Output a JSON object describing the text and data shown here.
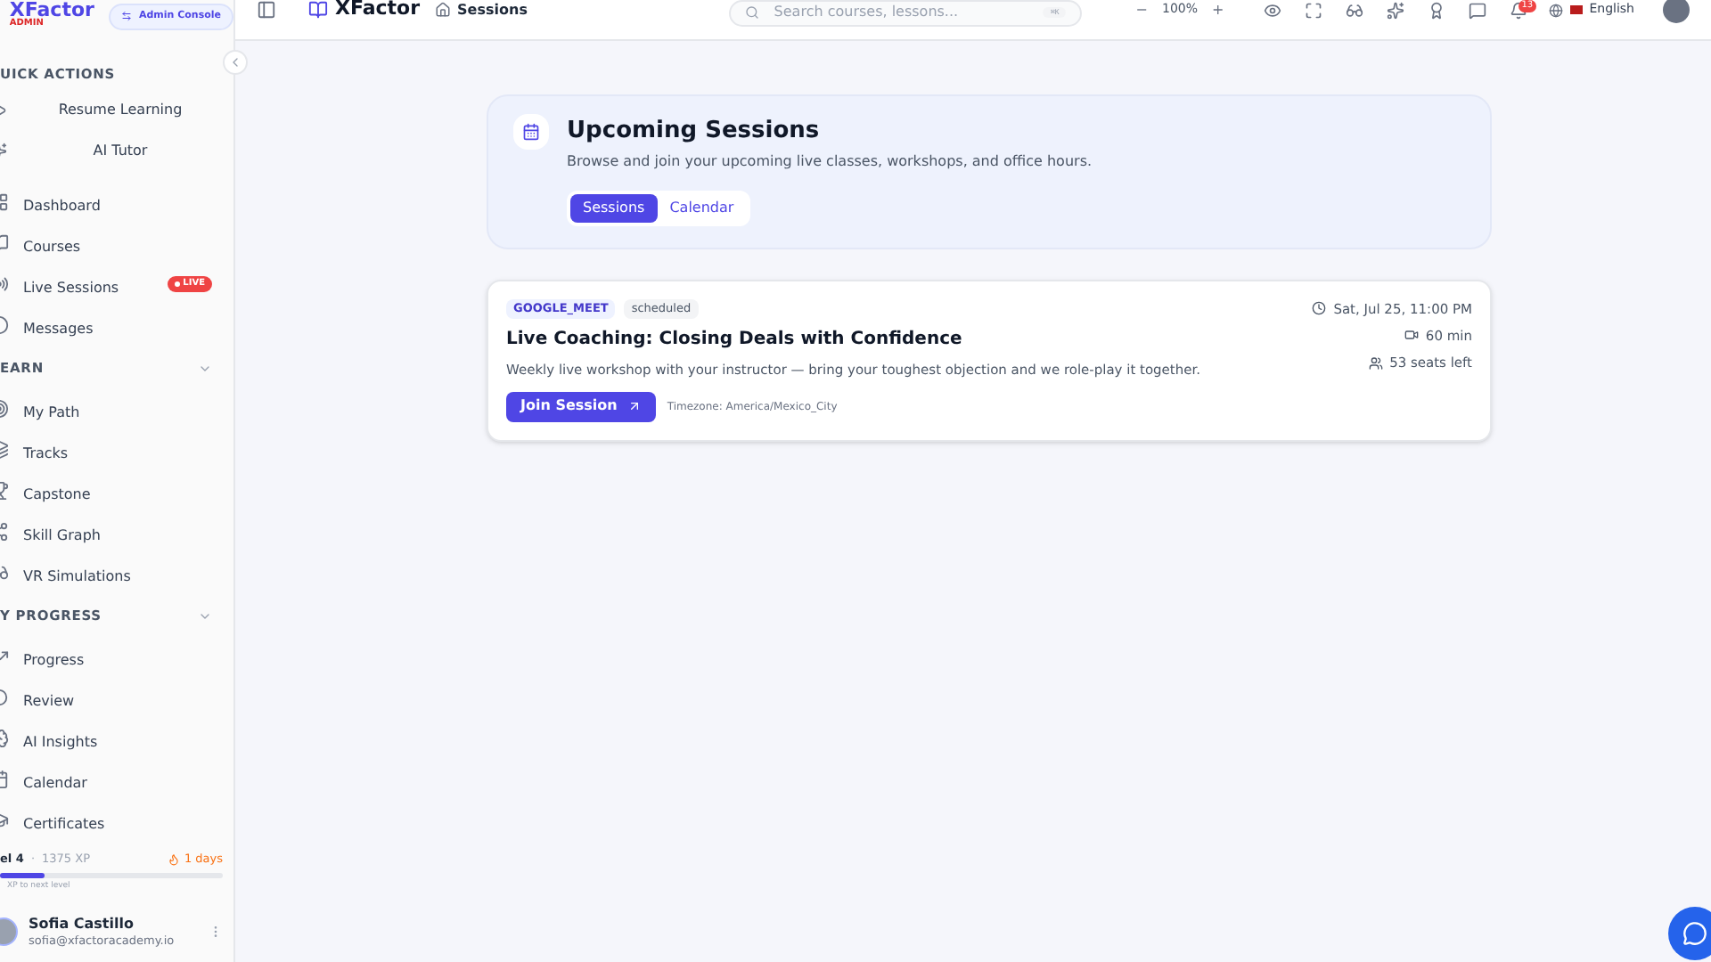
{
  "brand": {
    "name": "XFactor",
    "role": "ADMIN",
    "admin_button": "Admin Console"
  },
  "header": {
    "app_name": "XFactor",
    "breadcrumb": "Sessions",
    "search": {
      "placeholder": "Search courses, lessons...",
      "shortcut": "⌘K"
    },
    "zoom": "100%",
    "zoom_out": "−",
    "zoom_in": "+",
    "notifications": "13",
    "language": "English"
  },
  "sidebar": {
    "quick_actions_title": "UICK ACTIONS",
    "quick_actions": [
      "Resume Learning",
      "AI Tutor"
    ],
    "main_items": [
      {
        "label": "Dashboard"
      },
      {
        "label": "Courses"
      },
      {
        "label": "Live Sessions",
        "badge": "LIVE"
      },
      {
        "label": "Messages"
      }
    ],
    "sections": [
      {
        "title": "EARN",
        "expanded": true,
        "items": [
          "My Path",
          "Tracks",
          "Capstone",
          "Skill Graph",
          "VR Simulations"
        ]
      },
      {
        "title": "Y PROGRESS",
        "expanded": true,
        "items": [
          "Progress",
          "Review",
          "AI Insights",
          "Calendar",
          "Certificates"
        ]
      }
    ],
    "level": {
      "label": "el 4",
      "separator": "·",
      "xp": "1375 XP",
      "streak": "1 days",
      "level": 0.2,
      "hint": "XP to next level"
    },
    "user": {
      "name": "Sofia Castillo",
      "email": "sofia@xfactoracademy.io"
    }
  },
  "page": {
    "title": "Upcoming Sessions",
    "subtitle": "Browse and join your upcoming live classes, workshops, and office hours.",
    "tabs": [
      {
        "label": "Sessions",
        "selected": true
      },
      {
        "label": "Calendar",
        "selected": false
      }
    ]
  },
  "sessions": [
    {
      "platform": "GOOGLE_MEET",
      "status": "scheduled",
      "title": "Live Coaching: Closing Deals with Confidence",
      "description": "Weekly live workshop with your instructor — bring your toughest objection and we role-play it together.",
      "join": "Join Session",
      "timezone": "Timezone: America/Mexico_City",
      "date": "Sat, Jul 25, 11:00 PM",
      "duration": "60 min",
      "seats": "53 seats left"
    }
  ]
}
